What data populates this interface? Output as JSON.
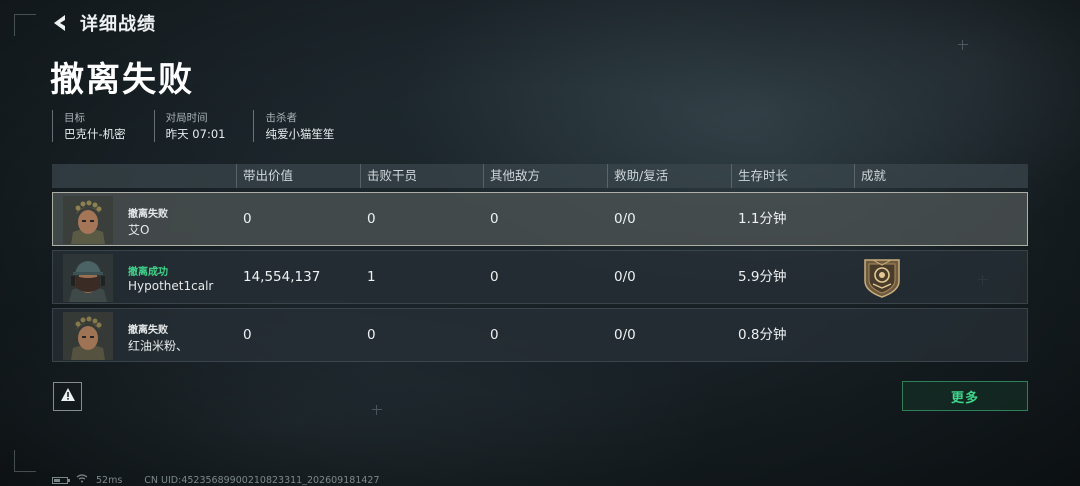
{
  "header": {
    "back_title": "详细战绩",
    "page_title": "撤离失败"
  },
  "meta": [
    {
      "label": "目标",
      "value": "巴克什-机密"
    },
    {
      "label": "对局时间",
      "value": "昨天 07:01"
    },
    {
      "label": "击杀者",
      "value": "纯爱小猫笙笙"
    }
  ],
  "table": {
    "columns": [
      "带出价值",
      "击败干员",
      "其他敌方",
      "救助/复活",
      "生存时长",
      "成就"
    ],
    "rows": [
      {
        "status": "撤离失败",
        "status_type": "fail",
        "name": "艾O",
        "value": "0",
        "kills": "0",
        "others": "0",
        "assist": "0/0",
        "survival": "1.1分钟",
        "achievement": "",
        "selected": true
      },
      {
        "status": "撤离成功",
        "status_type": "success",
        "name": "Hypothet1calr",
        "value": "14,554,137",
        "kills": "1",
        "others": "0",
        "assist": "0/0",
        "survival": "5.9分钟",
        "achievement": "medal-icon",
        "selected": false
      },
      {
        "status": "撤离失败",
        "status_type": "fail",
        "name": "红油米粉、",
        "value": "0",
        "kills": "0",
        "others": "0",
        "assist": "0/0",
        "survival": "0.8分钟",
        "achievement": "",
        "selected": false
      }
    ]
  },
  "buttons": {
    "more_label": "更多",
    "report_icon": "warning-icon"
  },
  "statusbar": {
    "ping": "52ms",
    "uid": "CN UID:45235689900210823311_202609181427"
  },
  "colors": {
    "success": "#3fd48a",
    "accent_border": "#2f7f58"
  }
}
